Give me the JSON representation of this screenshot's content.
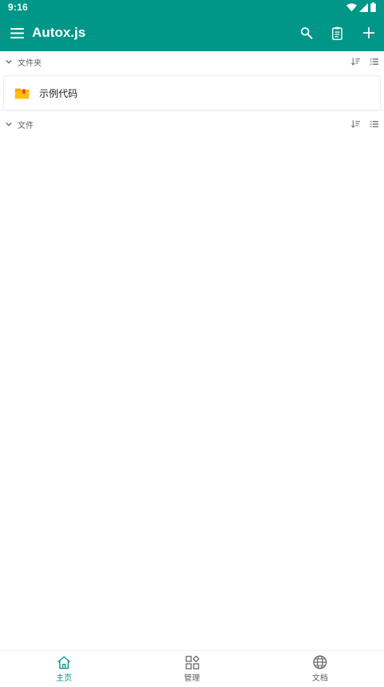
{
  "status_bar": {
    "time": "9:16",
    "icons": [
      "wifi-icon",
      "signal-icon",
      "battery-icon"
    ]
  },
  "app_bar": {
    "title": "Autox.js",
    "actions": [
      "search-icon",
      "clipboard-icon",
      "add-icon"
    ]
  },
  "sections": [
    {
      "title": "文件夹",
      "expanded": true,
      "items": [
        {
          "name": "示例代码",
          "icon": "folder-icon"
        }
      ]
    },
    {
      "title": "文件",
      "expanded": true,
      "items": []
    }
  ],
  "bottom_nav": {
    "items": [
      {
        "label": "主页",
        "icon": "home-icon",
        "active": true
      },
      {
        "label": "管理",
        "icon": "grid-icon",
        "active": false
      },
      {
        "label": "文档",
        "icon": "globe-icon",
        "active": false
      }
    ]
  },
  "colors": {
    "primary": "#009688",
    "background": "#ffffff",
    "text": "#212121",
    "secondary_text": "#616161",
    "folder_yellow": "#FFC107",
    "folder_mark": "#E53935"
  }
}
